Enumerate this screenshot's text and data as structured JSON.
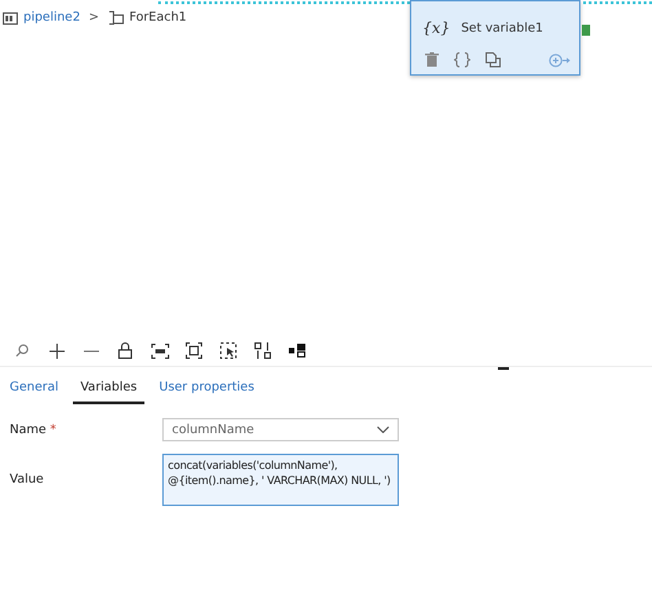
{
  "breadcrumb": [
    {
      "label": "pipeline2",
      "kind": "link"
    },
    {
      "label": ">",
      "kind": "separator"
    },
    {
      "label": "ForEach1",
      "kind": "current"
    }
  ],
  "activity": {
    "title": "Set variable1",
    "icon_text": "{x}",
    "selected": true
  },
  "tabs": [
    {
      "label": "General",
      "selected": false
    },
    {
      "label": "Variables",
      "selected": true
    },
    {
      "label": "User properties",
      "selected": false
    }
  ],
  "form": {
    "name_label": "Name",
    "required_mark": "*",
    "name_value": "columnName",
    "value_label": "Value",
    "value_text": "concat(variables('columnName'), @{item().name}, ' VARCHAR(MAX) NULL, ')"
  }
}
